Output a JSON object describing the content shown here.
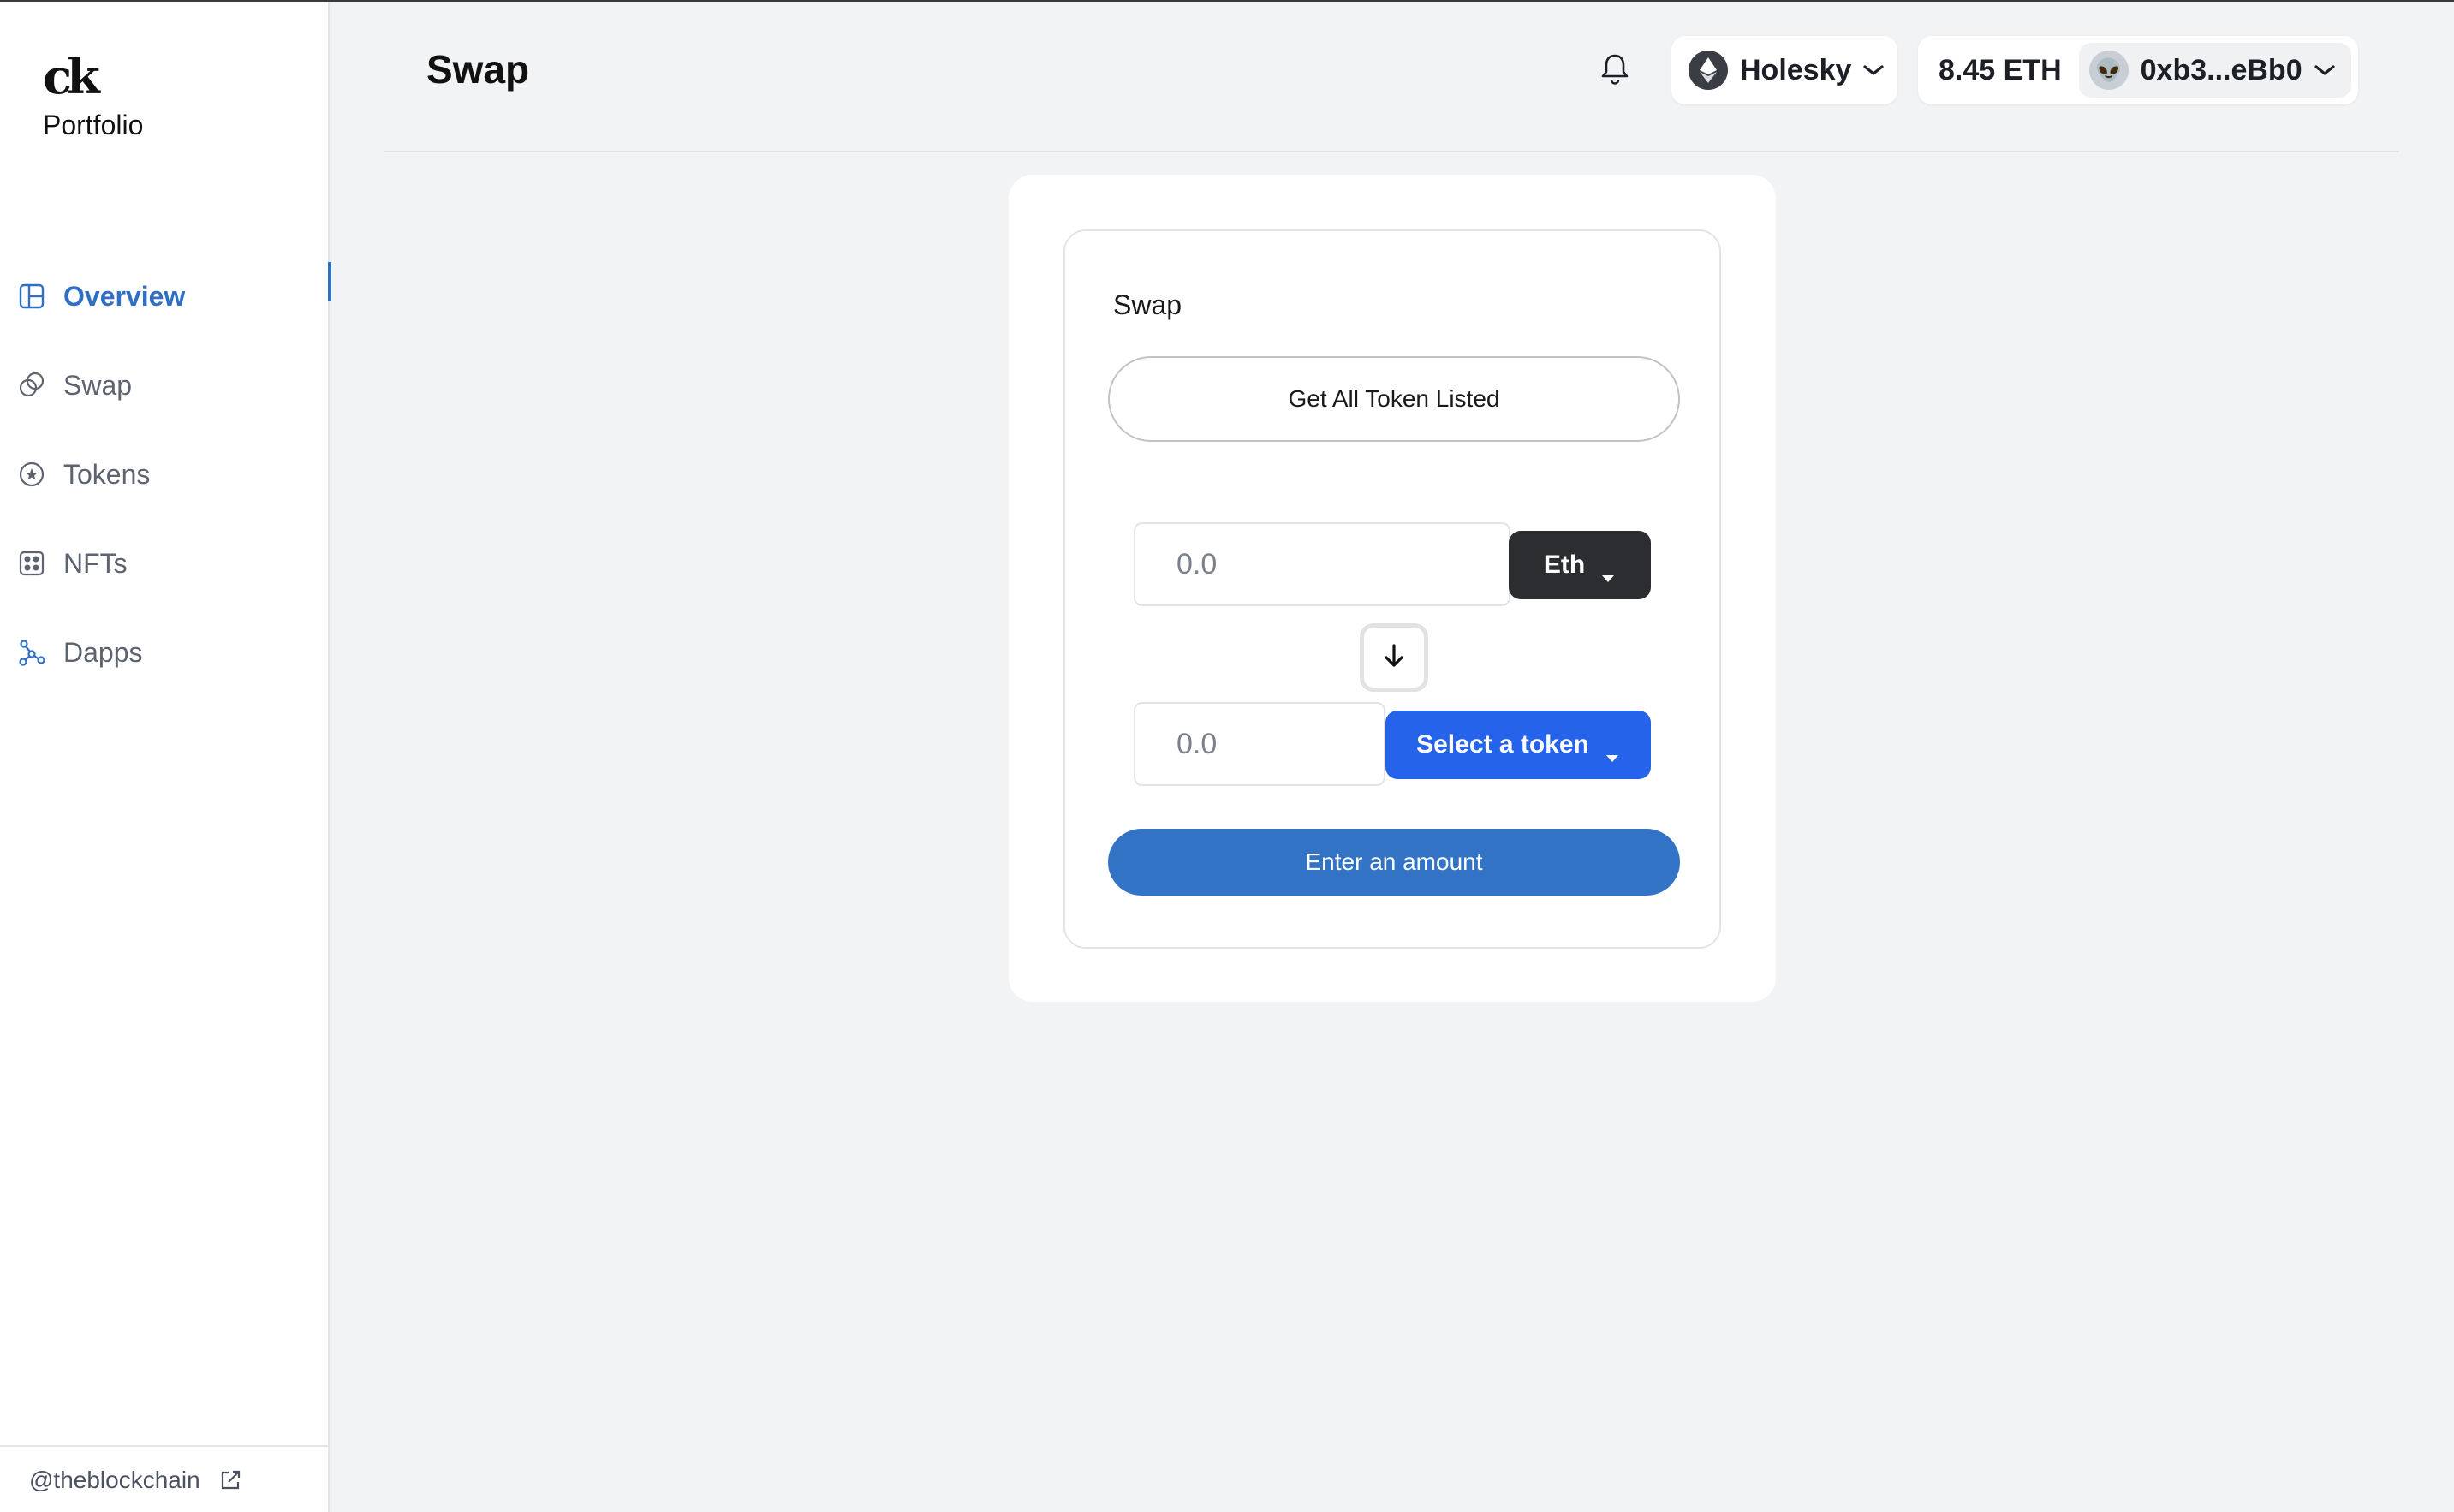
{
  "brand": {
    "logo": "ck",
    "name": "Portfolio"
  },
  "sidebar": {
    "items": [
      {
        "label": "Overview",
        "icon": "layout-icon",
        "active": true
      },
      {
        "label": "Swap",
        "icon": "swap-coins-icon",
        "active": false
      },
      {
        "label": "Tokens",
        "icon": "star-circle-icon",
        "active": false
      },
      {
        "label": "NFTs",
        "icon": "grid-dots-icon",
        "active": false
      },
      {
        "label": "Dapps",
        "icon": "network-icon",
        "active": false
      }
    ],
    "footer_link": "@theblockchain",
    "footer_icon": "external-link-icon"
  },
  "header": {
    "title": "Swap",
    "network": "Holesky",
    "balance": "8.45 ETH",
    "address": "0xb3...eBb0",
    "avatar_emoji": "👽"
  },
  "swap": {
    "title": "Swap",
    "list_button": "Get All Token Listed",
    "from_placeholder": "0.0",
    "from_token": "Eth",
    "to_placeholder": "0.0",
    "to_token": "Select a token",
    "submit": "Enter an amount"
  },
  "colors": {
    "accent": "#2f6fc4",
    "primary_button": "#3273c6",
    "select_token": "#2563eb",
    "dark_button": "#2b2d31",
    "background": "#f2f3f5"
  }
}
